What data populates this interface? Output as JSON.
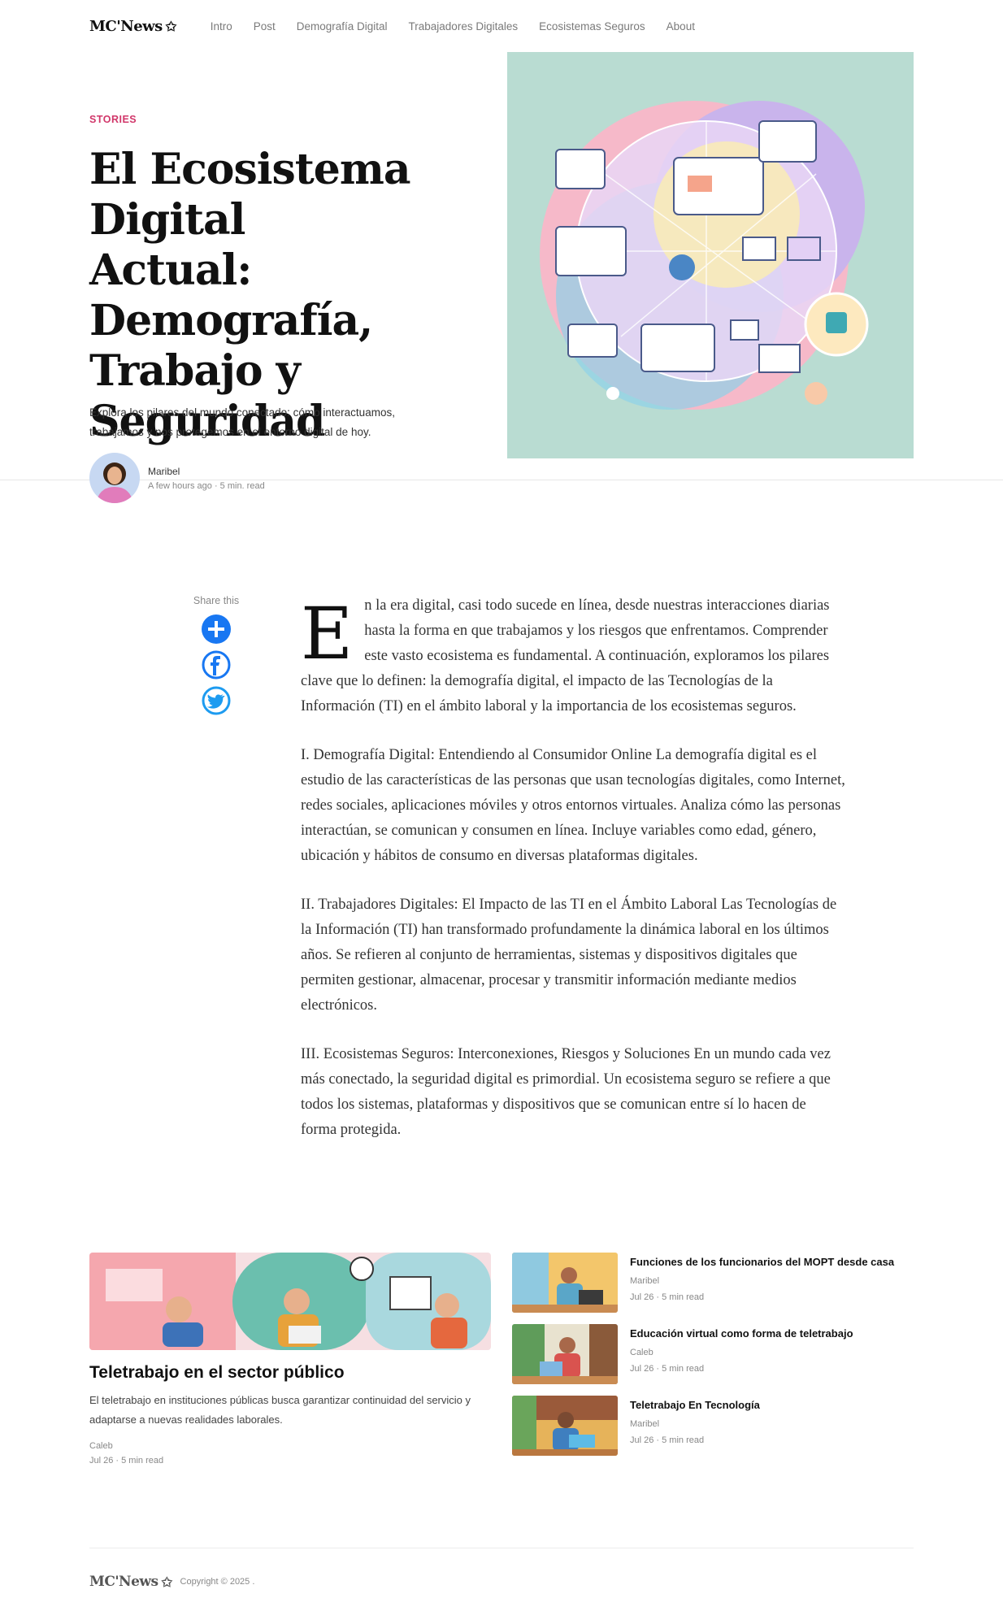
{
  "nav": {
    "logo": "MC'News",
    "links": [
      "Intro",
      "Post",
      "Demografía Digital",
      "Trabajadores Digitales",
      "Ecosistemas Seguros",
      "About"
    ]
  },
  "hero": {
    "kicker": "STORIES",
    "title": "El Ecosistema Digital Actual: Demografía, Trabajo y Seguridad",
    "subtitle": "Explora los pilares del mundo conectado: cómo interactuamos, trabajamos y nos protegemos en el entorno digital de hoy.",
    "author": "Maribel",
    "meta": "A few hours ago · 5 min. read"
  },
  "share": {
    "label": "Share this",
    "buttons": [
      "add-icon",
      "facebook-icon",
      "twitter-icon"
    ]
  },
  "article": {
    "dropcap": "E",
    "p1": "n la era digital, casi todo sucede en línea, desde nuestras interacciones diarias hasta la forma en que trabajamos y los riesgos que enfrentamos. Comprender este vasto ecosistema es fundamental. A continuación, exploramos los pilares clave que lo definen: la demografía digital, el impacto de las Tecnologías de la Información (TI) en el ámbito laboral y la importancia de los ecosistemas seguros.",
    "p2": "I. Demografía Digital: Entendiendo al Consumidor Online La demografía digital es el estudio de las características de las personas que usan tecnologías digitales, como Internet, redes sociales, aplicaciones móviles y otros entornos virtuales. Analiza cómo las personas interactúan, se comunican y consumen en línea. Incluye variables como edad, género, ubicación y hábitos de consumo en diversas plataformas digitales.",
    "p3": "II. Trabajadores Digitales: El Impacto de las TI en el Ámbito Laboral Las Tecnologías de la Información (TI) han transformado profundamente la dinámica laboral en los últimos años. Se refieren al conjunto de herramientas, sistemas y dispositivos digitales que permiten gestionar, almacenar, procesar y transmitir información mediante medios electrónicos.",
    "p4": "III. Ecosistemas Seguros: Interconexiones, Riesgos y Soluciones En un mundo cada vez más conectado, la seguridad digital es primordial. Un ecosistema seguro se refiere a que todos los sistemas, plataformas y dispositivos que se comunican entre sí lo hacen de forma protegida."
  },
  "featured": {
    "title": "Teletrabajo en el sector público",
    "description": "El teletrabajo en instituciones públicas busca garantizar continuidad del servicio y adaptarse a nuevas realidades laborales.",
    "author": "Caleb",
    "meta": "Jul 26 · 5 min read"
  },
  "related": [
    {
      "title": "Funciones de los funcionarios del MOPT desde casa",
      "author": "Maribel",
      "meta": "Jul 26 · 5 min read"
    },
    {
      "title": "Educación virtual como forma de teletrabajo",
      "author": "Caleb",
      "meta": "Jul 26 · 5 min read"
    },
    {
      "title": "Teletrabajo En Tecnología",
      "author": "Maribel",
      "meta": "Jul 26 · 5 min read"
    }
  ],
  "footer": {
    "logo": "MC'News",
    "copyright": "Copyright © 2025 ."
  },
  "colors": {
    "kicker": "#d1376a",
    "share_add": "#1877f2",
    "hero_bg": "#b9dcd2"
  }
}
